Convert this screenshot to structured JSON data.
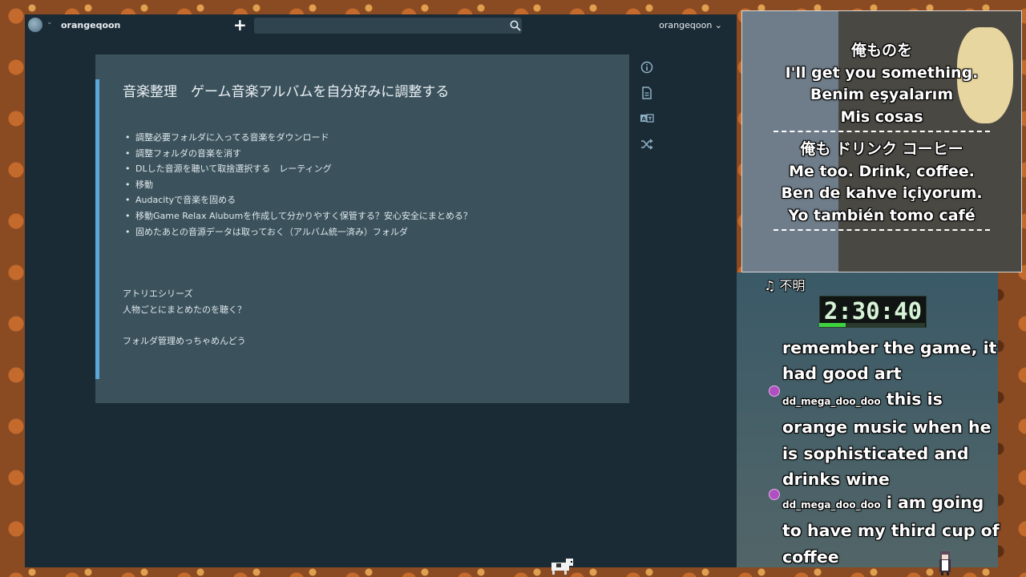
{
  "app": {
    "workspace": "orangeqoon",
    "user": "orangeqoon ⌄",
    "search": {
      "value": "",
      "placeholder": ""
    }
  },
  "note": {
    "title": "音楽整理　ゲーム音楽アルバムを自分好みに調整する",
    "items": [
      "調整必要フォルダに入ってる音楽をダウンロード",
      "調整フォルダの音楽を消す",
      "DLした音源を聴いて取捨選択する　レーティング",
      "移動",
      "Audacityで音楽を固める",
      "移動Game Relax Alubumを作成して分かりやすく保管する？安心安全にまとめる？",
      "固めたあとの音源データは取っておく（アルバム統一済み）フォルダ"
    ],
    "paragraphs": [
      "アトリエシリーズ",
      "人物ごとにまとめたのを聴く？",
      "フォルダ管理めっちゃめんどう"
    ]
  },
  "side_icons": [
    "info-icon",
    "document-icon",
    "translate-icon",
    "shuffle-icon"
  ],
  "overlay": {
    "lyrics_block_1": [
      "俺ものを",
      "I'll get you something.",
      "Benim eşyalarım",
      "Mis cosas"
    ],
    "lyrics_block_2": [
      "俺も ドリンク コーヒー",
      "Me too. Drink, coffee.",
      "Ben de kahve içiyorum.",
      "Yo también tomo café"
    ],
    "music_label": "♫ 不明",
    "timer": "2:30:40",
    "timer_progress": 0.25,
    "chat": [
      {
        "user": "",
        "text": "remember the game, it had good art"
      },
      {
        "user": "dd_mega_doo_doo",
        "text": "this is orange music when he is sophisticated and drinks wine"
      },
      {
        "user": "dd_mega_doo_doo",
        "text": "i am going to have my third cup of coffee"
      }
    ]
  },
  "colors": {
    "accent": "#5aa7d8",
    "card": "#3b525d",
    "app_bg": "#1b2b36",
    "timer_green": "#3fd23f"
  }
}
